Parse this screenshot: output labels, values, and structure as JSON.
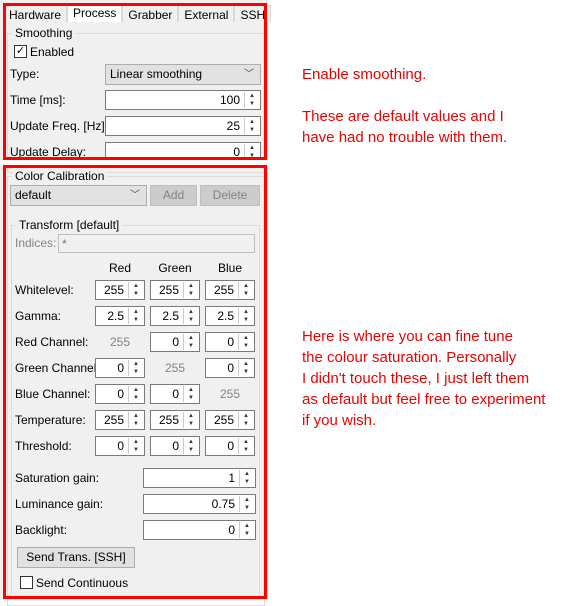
{
  "tabs": [
    {
      "label": "Hardware"
    },
    {
      "label": "Process",
      "active": true
    },
    {
      "label": "Grabber"
    },
    {
      "label": "External"
    },
    {
      "label": "SSH"
    }
  ],
  "smoothing": {
    "title": "Smoothing",
    "enabled_label": "Enabled",
    "enabled": true,
    "type_label": "Type:",
    "type_value": "Linear smoothing",
    "time_label": "Time [ms]:",
    "time_value": "100",
    "freq_label": "Update Freq. [Hz]:",
    "freq_value": "25",
    "delay_label": "Update Delay:",
    "delay_value": "0"
  },
  "calibration": {
    "title": "Color Calibration",
    "profile": "default",
    "add_label": "Add",
    "delete_label": "Delete"
  },
  "transform": {
    "title": "Transform [default]",
    "indices_label": "Indices:",
    "indices_placeholder": "*",
    "columns": [
      "Red",
      "Green",
      "Blue"
    ],
    "rows": [
      {
        "label": "Whitelevel:",
        "values": [
          "255",
          "255",
          "255"
        ],
        "fixed": []
      },
      {
        "label": "Gamma:",
        "values": [
          "2.5",
          "2.5",
          "2.5"
        ],
        "fixed": []
      },
      {
        "label": "Red Channel:",
        "values": [
          "255",
          "0",
          "0"
        ],
        "fixed": [
          0
        ]
      },
      {
        "label": "Green Channel:",
        "values": [
          "0",
          "255",
          "0"
        ],
        "fixed": [
          1
        ]
      },
      {
        "label": "Blue Channel:",
        "values": [
          "0",
          "0",
          "255"
        ],
        "fixed": [
          2
        ]
      },
      {
        "label": "Temperature:",
        "values": [
          "255",
          "255",
          "255"
        ],
        "fixed": []
      },
      {
        "label": "Threshold:",
        "values": [
          "0",
          "0",
          "0"
        ],
        "fixed": []
      }
    ],
    "saturation_label": "Saturation gain:",
    "saturation_value": "1",
    "luminance_label": "Luminance gain:",
    "luminance_value": "0.75",
    "backlight_label": "Backlight:",
    "backlight_value": "0",
    "send_label": "Send Trans. [SSH]",
    "continuous_label": "Send Continuous",
    "continuous": false
  },
  "notes": {
    "n1": "Enable smoothing.",
    "n2a": "These are default values and I",
    "n2b": "have had no trouble with them.",
    "n3": [
      "Here is where you can fine tune",
      "the colour saturation. Personally",
      "I didn't touch these, I just left them",
      "as default but feel free to experiment",
      "if you wish."
    ]
  },
  "colors": {
    "annotation": "#ff0000"
  }
}
